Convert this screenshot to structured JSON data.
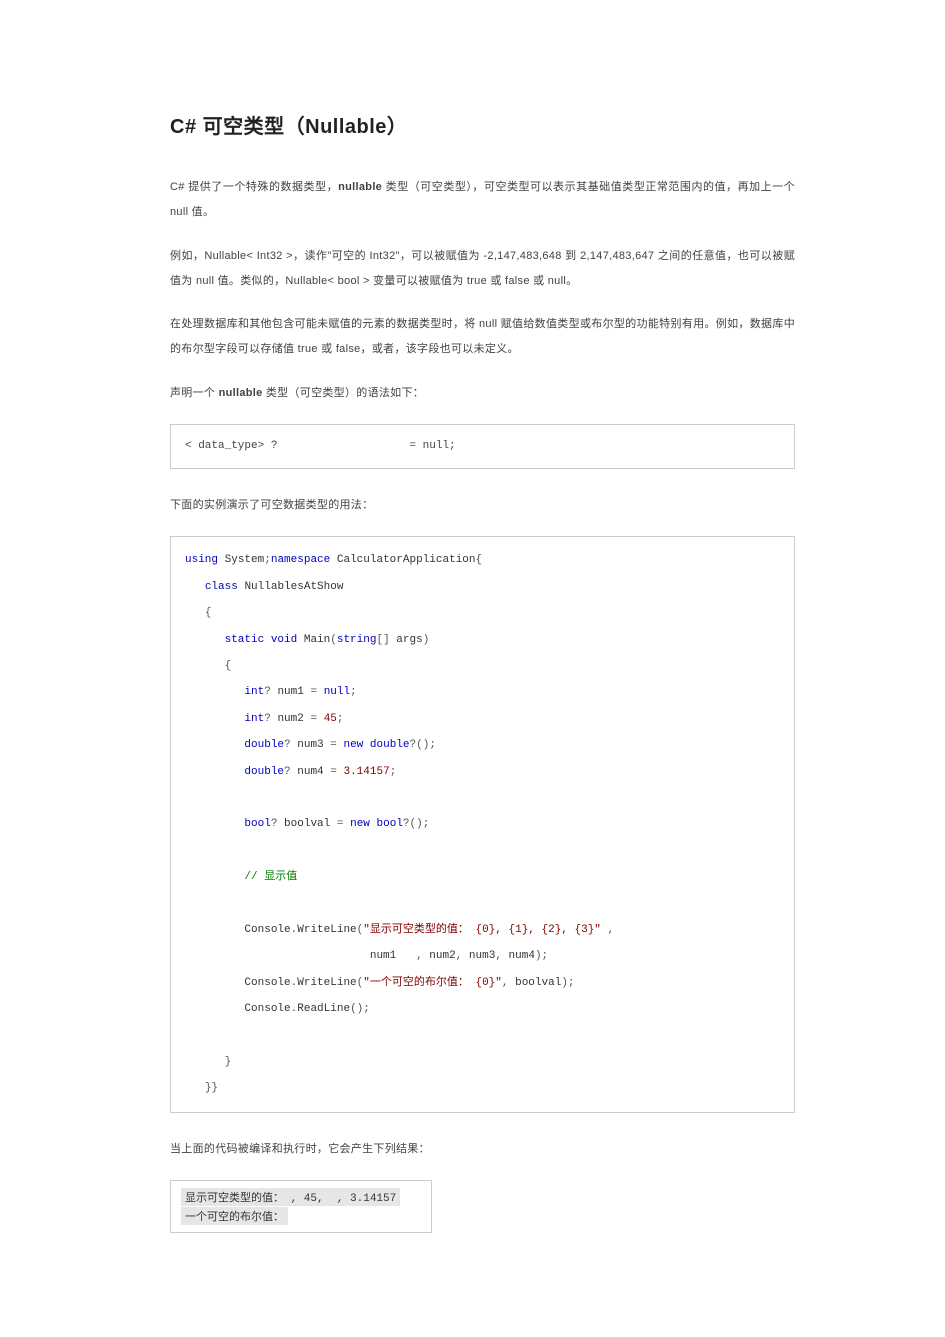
{
  "heading": "C#  可空类型（Nullable）",
  "paragraphs": {
    "p1_a": "C# 提供了一个特殊的数据类型，",
    "p1_b": "nullable",
    "p1_c": " 类型（可空类型），可空类型可以表示其基础值类型正常范围内的值，再加上一个  null  值。",
    "p2": "例如，Nullable< Int32 >，读作\"可空的 Int32\"，可以被赋值为 -2,147,483,648  到 2,147,483,647  之间的任意值，也可以被赋值为  null  值。类似的，Nullable< bool > 变量可以被赋值为 true  或 false  或 null。",
    "p3": "在处理数据库和其他包含可能未赋值的元素的数据类型时，将 null  赋值给数值类型或布尔型的功能特别有用。例如，数据库中的布尔型字段可以存储值  true  或 false，或者，该字段也可以未定义。",
    "p4_a": "声明一个 ",
    "p4_b": "nullable",
    "p4_c": " 类型（可空类型）的语法如下：",
    "p5": "下面的实例演示了可空数据类型的用法：",
    "p6": "当上面的代码被编译和执行时，它会产生下列结果："
  },
  "code": {
    "syntax": "< data_type> ?                    = null;",
    "example": {
      "l1": "using System;namespace CalculatorApplication{",
      "l2": "   class NullablesAtShow",
      "l3": "   {",
      "l4": "      static void Main(string[] args)",
      "l5": "      {",
      "l6": "         int? num1 = null;",
      "l7": "         int? num2 = 45;",
      "l8": "         double? num3 = new double?();",
      "l9": "         double? num4 = 3.14157;",
      "l10": "",
      "l11": "         bool? boolval = new bool?();",
      "l12": "",
      "l13": "         // 显示值",
      "l14": "",
      "l15": "         Console.WriteLine(\"显示可空类型的值： {0}, {1}, {2}, {3}\" ,",
      "l16": "                            num1   , num2, num3, num4);",
      "l17": "         Console.WriteLine(\"一个可空的布尔值： {0}\", boolval);",
      "l18": "         Console.ReadLine();",
      "l19": "",
      "l20": "      }",
      "l21": "   }}"
    }
  },
  "output": {
    "l1": "显示可空类型的值： , 45,  , 3.14157",
    "l2": "一个可空的布尔值："
  }
}
